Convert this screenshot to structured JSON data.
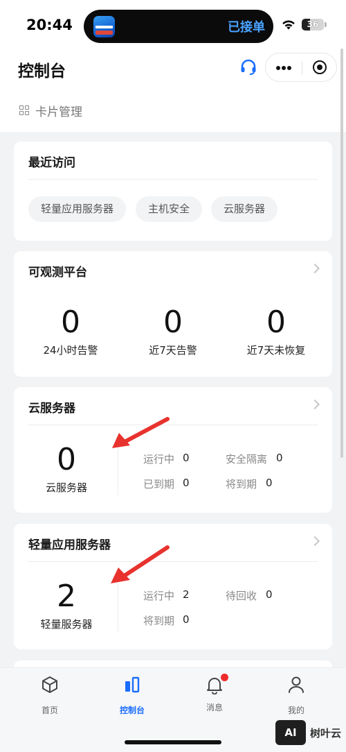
{
  "status_bar": {
    "time": "20:44",
    "island_text": "已接单",
    "battery": "36",
    "battery_level": 0.36
  },
  "header": {
    "title": "控制台",
    "card_management": "卡片管理"
  },
  "recent": {
    "title": "最近访问",
    "chips": [
      "轻量应用服务器",
      "主机安全",
      "云服务器"
    ]
  },
  "observability": {
    "title": "可观测平台",
    "metrics": [
      {
        "value": "0",
        "label": "24小时告警"
      },
      {
        "value": "0",
        "label": "近7天告警"
      },
      {
        "value": "0",
        "label": "近7天未恢复"
      }
    ]
  },
  "cloud_server": {
    "title": "云服务器",
    "count": "0",
    "count_label": "云服务器",
    "stats": [
      {
        "label": "运行中",
        "value": "0"
      },
      {
        "label": "安全隔离",
        "value": "0"
      },
      {
        "label": "已到期",
        "value": "0"
      },
      {
        "label": "将到期",
        "value": "0"
      }
    ]
  },
  "lighthouse": {
    "title": "轻量应用服务器",
    "count": "2",
    "count_label": "轻量服务器",
    "stats": [
      {
        "label": "运行中",
        "value": "2"
      },
      {
        "label": "待回收",
        "value": "0"
      },
      {
        "label": "将到期",
        "value": "0"
      }
    ]
  },
  "tab_bar": {
    "tabs": [
      {
        "label": "首页",
        "icon": "cube-icon"
      },
      {
        "label": "控制台",
        "icon": "console-icon",
        "active": true
      },
      {
        "label": "消息",
        "icon": "bell-icon",
        "badge": true
      },
      {
        "label": "我的",
        "icon": "user-icon"
      }
    ]
  },
  "watermark": {
    "logo": "AI",
    "text": "树叶云"
  },
  "colors": {
    "accent": "#1a6dff",
    "arrow": "#e8322e",
    "badge": "#ee2b2b"
  }
}
